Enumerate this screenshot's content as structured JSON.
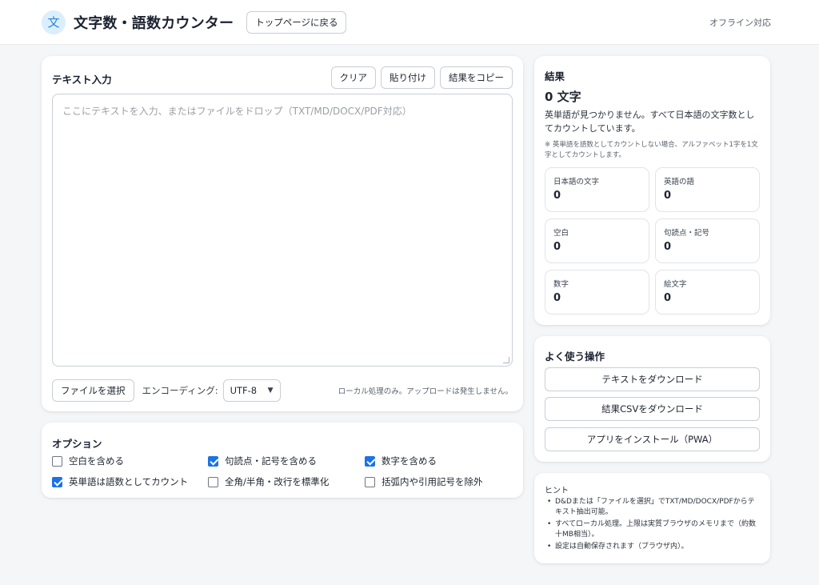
{
  "header": {
    "logo_glyph": "文",
    "title": "文字数・語数カウンター",
    "back_button": "トップページに戻る",
    "offline": "オフライン対応"
  },
  "input": {
    "title": "テキスト入力",
    "clear": "クリア",
    "paste": "貼り付け",
    "copy_result": "結果をコピー",
    "placeholder": "ここにテキストを入力、またはファイルをドロップ（TXT/MD/DOCX/PDF対応）",
    "file_button": "ファイルを選択",
    "encoding_label": "エンコーディング:",
    "encoding_value": "UTF-8",
    "local_note": "ローカル処理のみ。アップロードは発生しません。"
  },
  "options": {
    "title": "オプション",
    "items": [
      {
        "label": "空白を含める",
        "checked": false
      },
      {
        "label": "句読点・記号を含める",
        "checked": true
      },
      {
        "label": "数字を含める",
        "checked": true
      },
      {
        "label": "英単語は語数としてカウント",
        "checked": true
      },
      {
        "label": "全角/半角・改行を標準化",
        "checked": false
      },
      {
        "label": "括弧内や引用記号を除外",
        "checked": false
      }
    ]
  },
  "result": {
    "title": "結果",
    "count": "0 文字",
    "message": "英単語が見つかりません。すべて日本語の文字数としてカウントしています。",
    "note": "※ 英単語を語数としてカウントしない場合、アルファベット1字を1文字としてカウントします。",
    "stats": [
      {
        "label": "日本語の文字",
        "value": "0"
      },
      {
        "label": "英語の語",
        "value": "0"
      },
      {
        "label": "空白",
        "value": "0"
      },
      {
        "label": "句読点・記号",
        "value": "0"
      },
      {
        "label": "数字",
        "value": "0"
      },
      {
        "label": "絵文字",
        "value": "0"
      }
    ]
  },
  "actions": {
    "title": "よく使う操作",
    "download_text": "テキストをダウンロード",
    "download_csv": "結果CSVをダウンロード",
    "install_pwa": "アプリをインストール（PWA）"
  },
  "hints": {
    "title": "ヒント",
    "items": [
      "D&Dまたは「ファイルを選択」でTXT/MD/DOCX/PDFからテキスト抽出可能。",
      "すべてローカル処理。上限は実質ブラウザのメモリまで（約数十MB相当）。",
      "設定は自動保存されます（ブラウザ内）。"
    ]
  }
}
